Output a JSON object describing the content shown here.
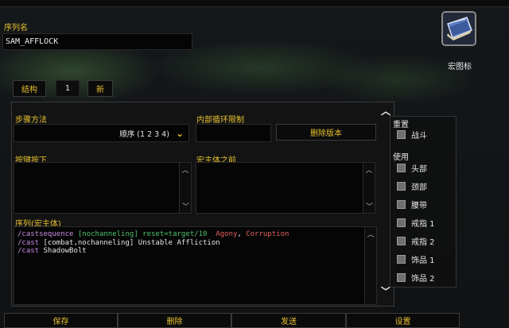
{
  "header": {
    "sequence_label": "序列名",
    "sequence_name": "SAM_AFFLOCK",
    "macro_icon_label": "宏图标"
  },
  "toolbar": {
    "structure": "结构",
    "number": "1",
    "new": "新"
  },
  "fields": {
    "step_method_label": "步骤方法",
    "step_method_value": "顺序 (1 2 3 4)",
    "inner_loop_label": "内部循环限制",
    "delete_version": "删除版本",
    "keypress_label": "按键按下",
    "pre_macro_label": "宏主体之前",
    "sequence_body_label": "序列(宏主体)"
  },
  "code": {
    "line1": {
      "kw": "/castsequence",
      "cond": "[nochanneling] reset=target/10",
      "spell1": "Agony",
      "sep": ",",
      "spell2": "Corruption"
    },
    "line2": {
      "kw": "/cast",
      "text": "[combat,nochanneling] Unstable Affliction"
    },
    "line3": {
      "kw": "/cast",
      "text": "ShadowBolt"
    }
  },
  "options": {
    "reset_label": "重置",
    "combat": "战斗",
    "use_label": "使用",
    "items": [
      "头部",
      "颈部",
      "腰带",
      "戒指 1",
      "戒指 2",
      "饰品 1",
      "饰品 2"
    ]
  },
  "bottom": {
    "save": "保存",
    "delete": "删除",
    "send": "发送",
    "settings": "设置"
  },
  "colors": {
    "accent": "#e7c02f",
    "command": "#c98be6",
    "condition": "#4fc26b",
    "spell": "#e0605d"
  }
}
